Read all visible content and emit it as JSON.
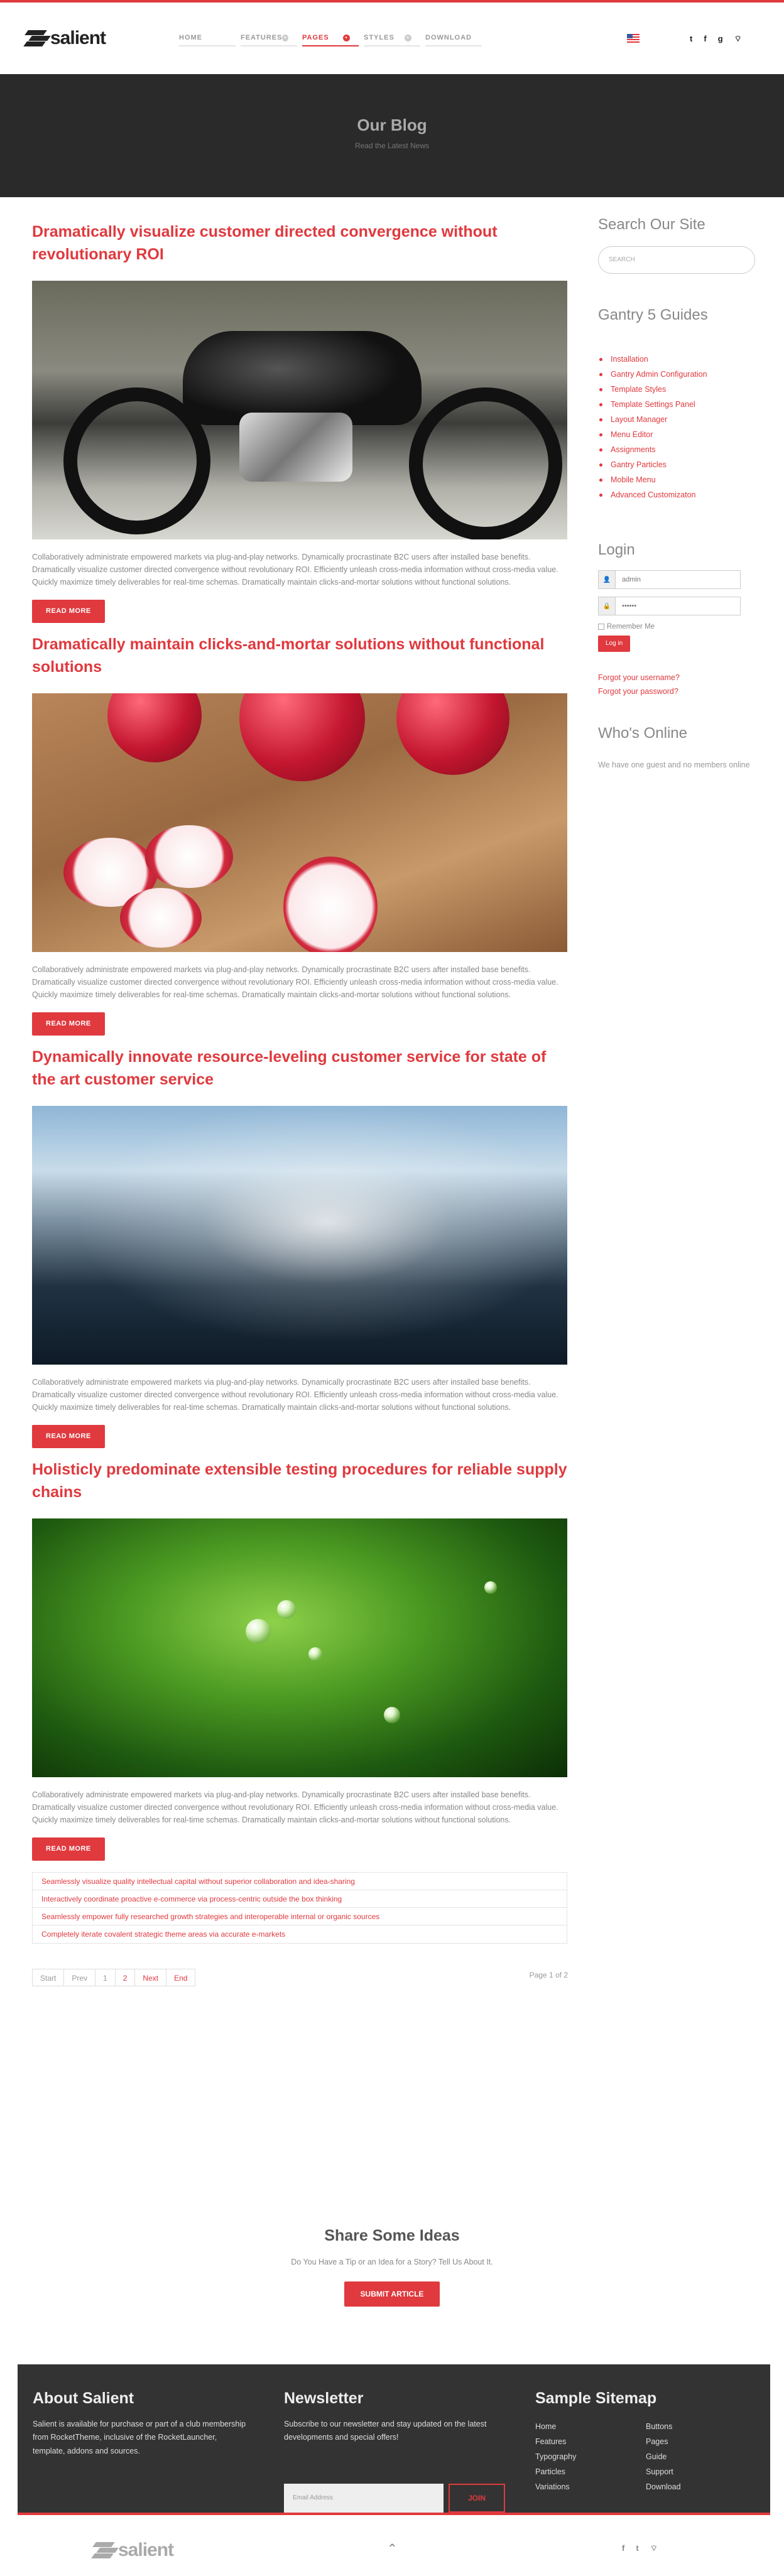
{
  "brand": {
    "name": "salient",
    "accent": "#e0393e"
  },
  "nav": [
    {
      "label": "HOME",
      "badge": ""
    },
    {
      "label": "FEATURES",
      "badge": "+"
    },
    {
      "label": "PAGES",
      "badge": "+",
      "active": true
    },
    {
      "label": "STYLES",
      "badge": "+"
    },
    {
      "label": "DOWNLOAD",
      "badge": ""
    }
  ],
  "header_social": [
    "t",
    "f",
    "g",
    "rss"
  ],
  "hero": {
    "title": "Our Blog",
    "subtitle": "Read the Latest News"
  },
  "posts": [
    {
      "title": "Dramatically visualize customer directed convergence without revolutionary ROI",
      "image": "motorcycle",
      "text": "Collaboratively administrate empowered markets via plug-and-play networks. Dynamically procrastinate B2C users after installed base benefits. Dramatically visualize customer directed convergence without revolutionary ROI. Efficiently unleash cross-media information without cross-media value. Quickly maximize timely deliverables for real-time schemas. Dramatically maintain clicks-and-mortar solutions without functional solutions.",
      "button": "READ MORE"
    },
    {
      "title": "Dramatically maintain clicks-and-mortar solutions without functional solutions",
      "image": "radishes",
      "text": "Collaboratively administrate empowered markets via plug-and-play networks. Dynamically procrastinate B2C users after installed base benefits. Dramatically visualize customer directed convergence without revolutionary ROI. Efficiently unleash cross-media information without cross-media value. Quickly maximize timely deliverables for real-time schemas. Dramatically maintain clicks-and-mortar solutions without functional solutions.",
      "button": "READ MORE"
    },
    {
      "title": "Dynamically innovate resource-leveling customer service for state of the art customer service",
      "image": "water-splash",
      "text": "Collaboratively administrate empowered markets via plug-and-play networks. Dynamically procrastinate B2C users after installed base benefits. Dramatically visualize customer directed convergence without revolutionary ROI. Efficiently unleash cross-media information without cross-media value. Quickly maximize timely deliverables for real-time schemas. Dramatically maintain clicks-and-mortar solutions without functional solutions.",
      "button": "READ MORE"
    },
    {
      "title": "Holisticly predominate extensible testing procedures for reliable supply chains",
      "image": "leaf-drops",
      "text": "Collaboratively administrate empowered markets via plug-and-play networks. Dynamically procrastinate B2C users after installed base benefits. Dramatically visualize customer directed convergence without revolutionary ROI. Efficiently unleash cross-media information without cross-media value. Quickly maximize timely deliverables for real-time schemas. Dramatically maintain clicks-and-mortar solutions without functional solutions.",
      "button": "READ MORE"
    }
  ],
  "more_links": [
    "Seamlessly visualize quality intellectual capital without superior collaboration and idea-sharing",
    "Interactively coordinate proactive e-commerce via process-centric outside the box thinking",
    "Seamlessly empower fully researched growth strategies and interoperable internal or organic sources",
    "Completely iterate covalent strategic theme areas via accurate e-markets"
  ],
  "pagination": {
    "items": [
      "Start",
      "Prev",
      "1",
      "2",
      "Next",
      "End"
    ],
    "count": "Page 1 of 2"
  },
  "sidebar": {
    "search": {
      "title": "Search Our Site",
      "placeholder": "SEARCH"
    },
    "guides": {
      "title": "Gantry 5 Guides",
      "items": [
        "Installation",
        "Gantry Admin Configuration",
        "Template Styles",
        "Template Settings Panel",
        "Layout Manager",
        "Menu Editor",
        "Assignments",
        "Gantry Particles",
        "Mobile Menu",
        "Advanced Customizaton"
      ]
    },
    "login": {
      "title": "Login",
      "username": "admin",
      "password": "••••••",
      "remember": "Remember Me",
      "button": "Log in",
      "forgot_user": "Forgot your username?",
      "forgot_pass": "Forgot your password?"
    },
    "online": {
      "title": "Who's Online",
      "text": "We have one guest and no members online"
    }
  },
  "ideas": {
    "title": "Share Some Ideas",
    "subtitle": "Do You Have a Tip or an Idea for a Story? Tell Us About It.",
    "button": "SUBMIT ARTICLE"
  },
  "footer": {
    "about": {
      "title": "About Salient",
      "text": "Salient is available for purchase or part of a club membership from RocketTheme, inclusive of the RocketLauncher, template, addons and sources."
    },
    "newsletter": {
      "title": "Newsletter",
      "text": "Subscribe to our newsletter and stay updated on the latest developments and special offers!",
      "placeholder": "Email Address",
      "button": "JOIN"
    },
    "sitemap": {
      "title": "Sample Sitemap",
      "items": [
        "Home",
        "Buttons",
        "Features",
        "Pages",
        "Typography",
        "Guide",
        "Particles",
        "Support",
        "Variations",
        "Download"
      ]
    }
  },
  "bottom": {
    "logo": "salient",
    "social": [
      "f",
      "t",
      "rss"
    ]
  }
}
